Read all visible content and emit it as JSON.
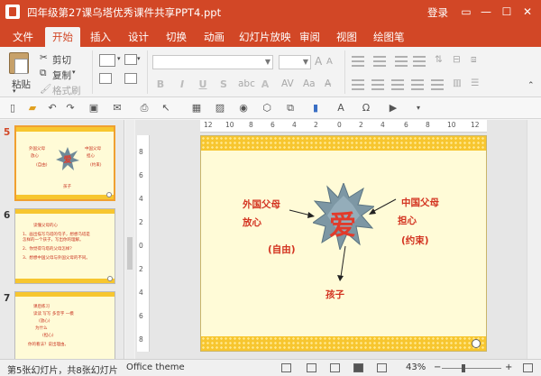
{
  "window": {
    "title": "四年级第27课乌塔优秀课件共享PPT4.ppt",
    "login": "登录",
    "accent": "#d24726"
  },
  "tabs": [
    "文件",
    "开始",
    "插入",
    "设计",
    "切换",
    "动画",
    "幻灯片放映",
    "审阅",
    "视图",
    "绘图笔"
  ],
  "active_tab": "开始",
  "ribbon": {
    "paste": "粘贴",
    "cut": "剪切",
    "copy": "复制",
    "format_painter": "格式刷",
    "format_buttons": [
      "B",
      "I",
      "U",
      "S",
      "A"
    ]
  },
  "thumbnails": [
    {
      "number": "5",
      "selected": true,
      "texts": [
        "外国父母",
        "放心",
        "(自由)",
        "中国父母",
        "担心",
        "(约束)",
        "孩子"
      ]
    },
    {
      "number": "6",
      "selected": false,
      "texts": [
        "读懂父母的心",
        "1、画出描写乌塔的句子，想想乌塔是",
        "怎样的一个孩子，写出你的理解。",
        "2、你觉得乌塔的父母怎样？",
        "3、想想中国父母与外国父母的不同。"
      ]
    },
    {
      "number": "7",
      "selected": false,
      "texts": [
        "课后练习",
        "读读 写写 多音字 一模",
        "(放心)",
        "为什么",
        "(担心)",
        "你的看法？说出理由。"
      ]
    }
  ],
  "slide": {
    "left_label_1": "外国父母",
    "left_label_2": "放心",
    "left_paren": "(自由)",
    "right_label_1": "中国父母",
    "right_label_2": "担心",
    "right_paren": "(约束)",
    "center_char": "爱",
    "bottom_label": "孩子",
    "text_color": "#d33421",
    "band_color": "#f7c62f",
    "background": "#fffbd7"
  },
  "ruler": {
    "h_ticks": [
      "12",
      "10",
      "8",
      "6",
      "4",
      "2",
      "0",
      "2",
      "4",
      "6",
      "8",
      "10",
      "12"
    ],
    "v_ticks": [
      "8",
      "6",
      "4",
      "2",
      "0",
      "2",
      "4",
      "6",
      "8"
    ]
  },
  "status": {
    "slide_info": "第5张幻灯片，共8张幻灯片",
    "theme": "Office theme",
    "zoom": "43%",
    "zoom_minus": "−",
    "zoom_plus": "+"
  }
}
